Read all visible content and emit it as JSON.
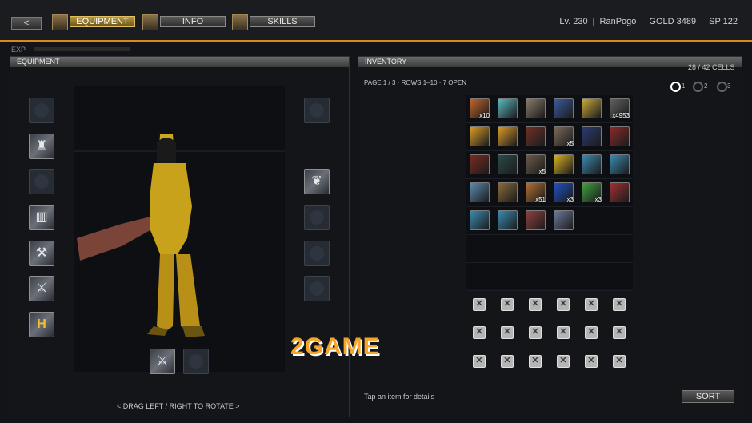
{
  "header": {
    "back_label": "<",
    "tabs": [
      {
        "label": "EQUIPMENT",
        "active": true
      },
      {
        "label": "INFO",
        "active": false
      },
      {
        "label": "SKILLS",
        "active": false
      }
    ],
    "level": "Lv. 230",
    "separator": "|",
    "player_name": "RanPogo",
    "gold": "GOLD 3489",
    "sp": "SP 122"
  },
  "exp_label": "EXP",
  "equipment": {
    "title": "EQUIPMENT",
    "rotate_hint": "< DRAG LEFT / RIGHT TO ROTATE >",
    "left_slots": [
      "empty",
      "filled",
      "empty",
      "filled",
      "filled",
      "filled",
      "filled"
    ],
    "right_slots": [
      "empty",
      "filled",
      "empty",
      "empty",
      "empty"
    ],
    "bottom_slots": [
      "filled",
      "empty"
    ]
  },
  "inventory": {
    "title": "INVENTORY",
    "cells_count": "28 / 42 CELLS",
    "page_info": "PAGE 1 / 3",
    "rows_info": "ROWS 1–10",
    "open_info": "7 OPEN",
    "dot": "·",
    "pages": [
      "1",
      "2",
      "3"
    ],
    "active_page": 0,
    "items": [
      {
        "color": "#c0652a",
        "qty": "x10"
      },
      {
        "color": "#58b8c0",
        "qty": ""
      },
      {
        "color": "#8a7a6a",
        "qty": ""
      },
      {
        "color": "#3a5aa0",
        "qty": ""
      },
      {
        "color": "#c8a838",
        "qty": ""
      },
      {
        "color": "#606060",
        "qty": "x4953"
      },
      {
        "color": "#d89a28",
        "qty": ""
      },
      {
        "color": "#d89a28",
        "qty": ""
      },
      {
        "color": "#703028",
        "qty": ""
      },
      {
        "color": "#7a6a5a",
        "qty": "x5"
      },
      {
        "color": "#2a3a70",
        "qty": ""
      },
      {
        "color": "#8a2a2a",
        "qty": ""
      },
      {
        "color": "#7a2a22",
        "qty": ""
      },
      {
        "color": "#2a4a48",
        "qty": ""
      },
      {
        "color": "#6a5a4a",
        "qty": "x5"
      },
      {
        "color": "#d8b020",
        "qty": ""
      },
      {
        "color": "#3a8ab0",
        "qty": ""
      },
      {
        "color": "#3a8ab0",
        "qty": ""
      },
      {
        "color": "#5a8ab0",
        "qty": ""
      },
      {
        "color": "#8a6a3a",
        "qty": ""
      },
      {
        "color": "#b07030",
        "qty": "x51"
      },
      {
        "color": "#2050c0",
        "qty": "x3"
      },
      {
        "color": "#40a040",
        "qty": "x3"
      },
      {
        "color": "#a03030",
        "qty": ""
      },
      {
        "color": "#3a8ab0",
        "qty": ""
      },
      {
        "color": "#3a8ab0",
        "qty": ""
      },
      {
        "color": "#904040",
        "qty": ""
      },
      {
        "color": "#6a7a9a",
        "qty": ""
      }
    ],
    "locked_mark": "✕",
    "tap_hint": "Tap an item for details",
    "sort_label": "SORT"
  },
  "watermark": "2GAME"
}
